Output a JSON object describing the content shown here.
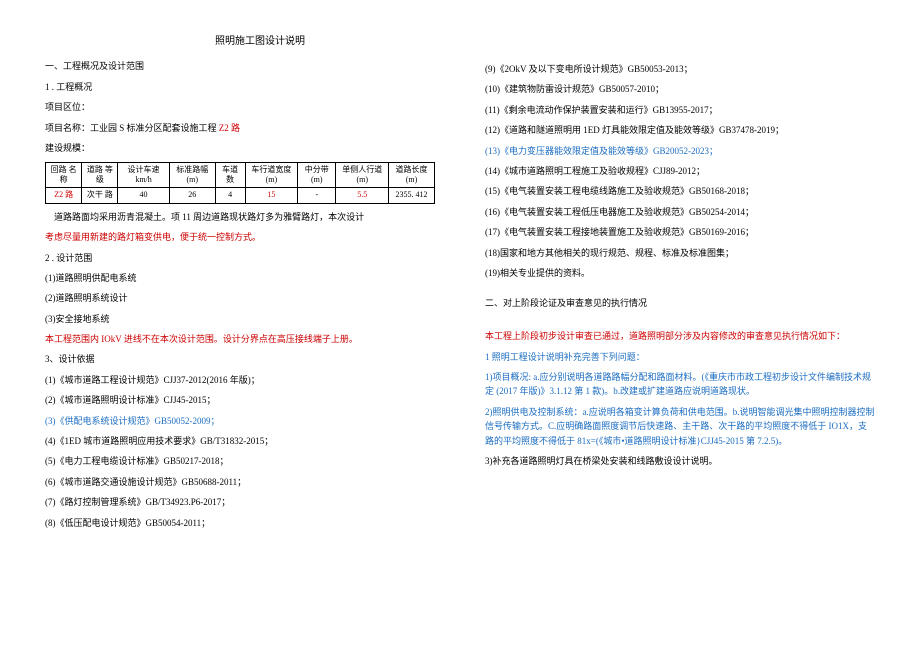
{
  "title": "照明施工图设计说明",
  "left": {
    "h1": "一、工程概况及设计范围",
    "s1_num": "1   . 工程概况",
    "loc": "项目区位：",
    "name": "项目名称：工业园 S 标准分区配套设施工程 Z2 路",
    "name_red_part": "Z2 路",
    "scale": "建设规模：",
    "table": {
      "headers": [
        "回路\n名称",
        "道路\n等级",
        "设计车速\nkm/h",
        "标准路幅\n(m)",
        "车道\n数",
        "车行道宽度\n(m)",
        "中分带(m)",
        "单侧人行道\n(m)",
        "道路长度(m)"
      ],
      "row": [
        "Z2 路",
        "次干\n路",
        "40",
        "26",
        "4",
        "15",
        "-",
        "5.5",
        "2355. 412"
      ]
    },
    "road_note1": "道路路面均采用沥青混凝土。项 11 周边道路现状路灯多为雅臂路灯，本次设计",
    "road_note2": "考虑尽量用新建的路灯箱变供电，便于统一控制方式。",
    "s2_num": "2     . 设计范围",
    "s2_items": [
      "(1)道路照明供配电系统",
      "(2)道路照明系统设计",
      "(3)安全接地系统"
    ],
    "s2_red": "本工程范围内 IOkV 进线不在本次设计范围。设计分界点在高压接线端子上册。",
    "s3_num": "3、设计依据",
    "s3_items": [
      "(1)《城市道路工程设计规范》CJJ37-2012(2016 年版)；",
      "(2)《城市道路照明设计标准》CJJ45-2015；",
      "(3)《供配电系统设计规范》GB50052-2009；",
      "(4)《1ED 城市道路照明应用技术要求》GB/T31832-2015；",
      "(5)《电力工程电缆设计标准》GB50217-2018；",
      "(6)《城市道路交通设施设计规范》GB50688-2011；",
      "(7)《路灯控制管理系统》GB/T34923.P6-2017；",
      "(8)《低压配电设计规范》GB50054-2011；"
    ]
  },
  "right": {
    "s3_cont": [
      "(9)《2OkV 及以下变电所设计规范》GB50053-2013；",
      "(10)《建筑物防雷设计规范》GB50057-2010；",
      "(11)《剩余电流动作保护装置安装和运行》GB13955-2017；",
      "(12)《道路和隧道照明用 1ED 灯具能效限定值及能效等级》GB37478-2019；",
      "(13)《电力变压器能效限定值及能效等级》GB20052-2023；",
      "(14)《城市道路照明工程施工及验收规程》CJJ89-2012；",
      "(15)《电气装置安装工程电缆线路施工及验收规范》GB50168-2018；",
      "(16)《电气装置安装工程低压电器施工及验收规范》GB50254-2014；",
      "(17)《电气装置安装工程接地装置施工及验收规范》GB50169-2016；",
      "(18)国家和地方其他相关的现行规范、规程、标准及标准图集；",
      "(19)相关专业提供的资料。"
    ],
    "h2": "二、对上阶段论证及审查意见的执行情况",
    "p1": "本工程上阶段初步设计审查已通过，道路照明部分涉及内容修改的审查意见执行情况如下：",
    "n1": "1     照明工程设计说明补充完善下列问题：",
    "b1": "1)项目概况: a.应分别说明各道路路幅分配和路面材料。(《重庆市市政工程初步设计文件编制技术规定 (2017 年版)》3.1.12 第 1 款)。b.改建或扩建道路应说明道路现状。",
    "b2": "2)照明供电及控制系统：a.应说明各箱变计算负荷和供电范围。b.说明智能调光集中照明控制器控制信号传输方式。C.应明确路面照度调节后快速路、主干路、次干路的平均照度不得低于 IO1X，支路的平均照度不得低于 81x=(《城市•道路照明设计标准}CJJ45-2015 第 7.2.5)。",
    "b3": "3)补充各道路照明灯具在桥梁处安装和线路敷设设计说明。"
  }
}
